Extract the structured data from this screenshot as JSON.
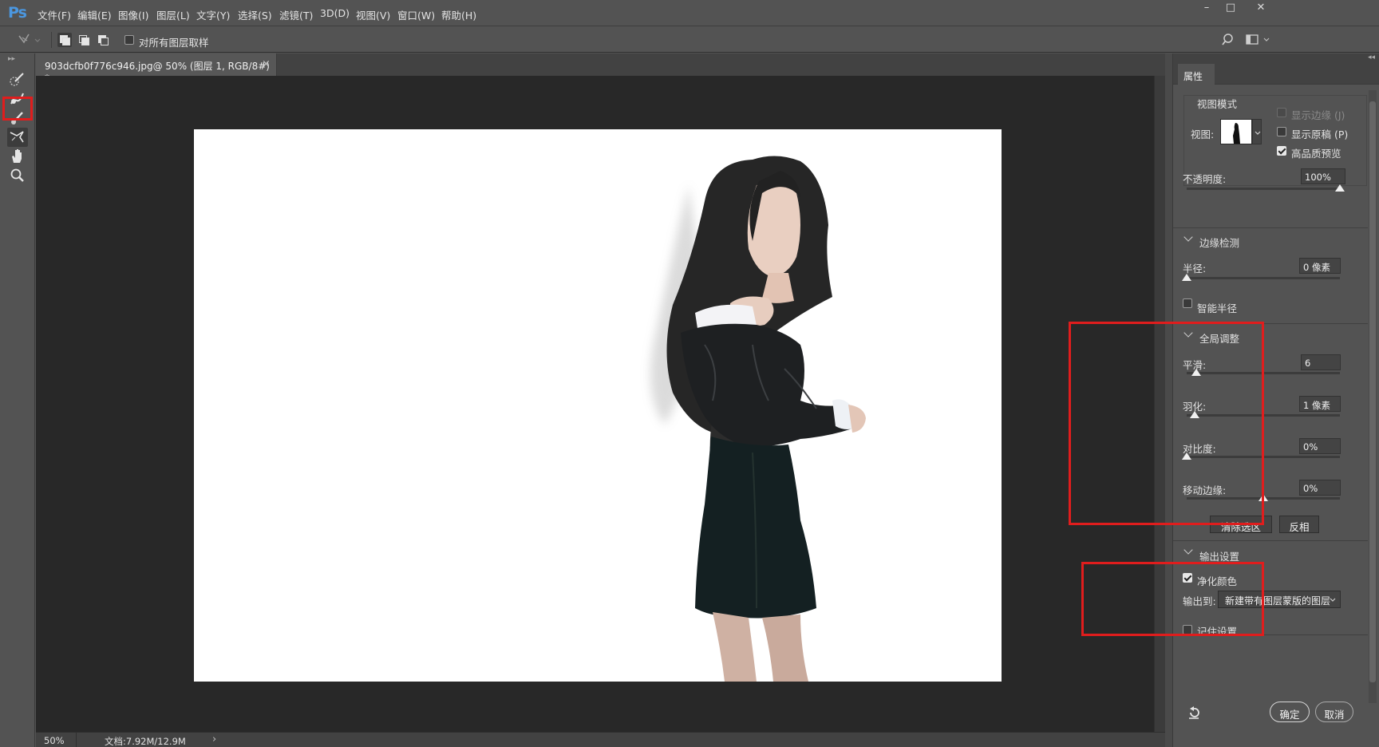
{
  "app": {
    "logo": "Ps"
  },
  "menu": [
    {
      "label": "文件(F)"
    },
    {
      "label": "编辑(E)"
    },
    {
      "label": "图像(I)"
    },
    {
      "label": "图层(L)"
    },
    {
      "label": "文字(Y)"
    },
    {
      "label": "选择(S)"
    },
    {
      "label": "滤镜(T)"
    },
    {
      "label": "3D(D)"
    },
    {
      "label": "视图(V)"
    },
    {
      "label": "窗口(W)"
    },
    {
      "label": "帮助(H)"
    }
  ],
  "window_controls": {
    "minimize": "–",
    "restore": "□",
    "close": "✕"
  },
  "options": {
    "sample_all_layers": "对所有图层取样",
    "sample_all_layers_checked": false
  },
  "document": {
    "tab_title": "903dcfb0f776c946.jpg@ 50% (图层 1, RGB/8#) *",
    "tab_close": "×"
  },
  "status": {
    "zoom": "50%",
    "doc_size": "文档:7.92M/12.9M",
    "arrow": "›"
  },
  "panel": {
    "tab": "属性",
    "view_mode": {
      "title": "视图模式",
      "view_label": "视图:",
      "show_edges": "显示边缘 (J)",
      "show_edges_checked": false,
      "show_original": "显示原稿 (P)",
      "show_original_checked": false,
      "high_quality": "高品质预览",
      "high_quality_checked": true
    },
    "opacity": {
      "label": "不透明度:",
      "value": "100%",
      "level": 1.0
    },
    "edge_detection": {
      "title": "边缘检测",
      "radius_label": "半径:",
      "radius_value": "0 像素",
      "radius_level": 0.0,
      "smart_radius": "智能半径",
      "smart_radius_checked": false
    },
    "global_refinements": {
      "title": "全局调整",
      "smooth_label": "平滑:",
      "smooth_value": "6",
      "smooth_level": 0.06,
      "feather_label": "羽化:",
      "feather_value": "1 像素",
      "feather_level": 0.05,
      "contrast_label": "对比度:",
      "contrast_value": "0%",
      "contrast_level": 0.0,
      "shift_edge_label": "移动边缘:",
      "shift_edge_value": "0%",
      "shift_edge_level": 0.5,
      "clear_selection": "清除选区",
      "invert": "反相"
    },
    "output": {
      "title": "输出设置",
      "decontaminate": "净化颜色",
      "decontaminate_checked": true,
      "output_to_label": "输出到:",
      "output_to_value": "新建带有图层蒙版的图层"
    },
    "remember": "记住设置",
    "ok": "确定",
    "cancel": "取消"
  },
  "colors": {
    "highlight": "#e01d1d",
    "ui_bg": "#535353",
    "canvas_bg": "#282828"
  }
}
